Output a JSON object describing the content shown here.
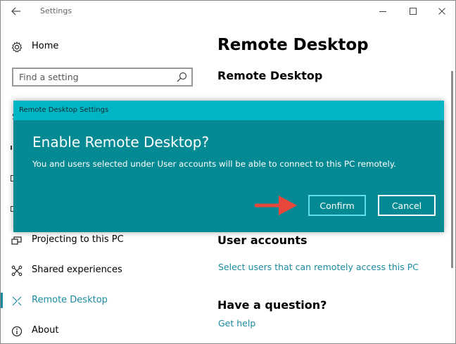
{
  "window": {
    "title": "Settings"
  },
  "sidebar": {
    "home_label": "Home",
    "search_placeholder": "Find a setting",
    "items": [
      {
        "label": "Projecting to this PC",
        "icon": "projector-icon",
        "active": false
      },
      {
        "label": "Shared experiences",
        "icon": "shared-experiences-icon",
        "active": false
      },
      {
        "label": "Remote Desktop",
        "icon": "remote-desktop-icon",
        "active": true
      },
      {
        "label": "About",
        "icon": "info-icon",
        "active": false
      }
    ],
    "peek_letter": "S"
  },
  "main": {
    "page_title": "Remote Desktop",
    "section_remote_desktop": "Remote Desktop",
    "section_user_accounts": "User accounts",
    "link_select_users": "Select users that can remotely access this PC",
    "section_question": "Have a question?",
    "link_get_help": "Get help"
  },
  "dialog": {
    "title": "Remote Desktop Settings",
    "heading": "Enable Remote Desktop?",
    "message": "You and users selected under User accounts will be able to connect to this PC remotely.",
    "confirm_label": "Confirm",
    "cancel_label": "Cancel"
  },
  "colors": {
    "accent": "#1a8a9e",
    "dialog_bg": "#058a94",
    "dialog_titlebar": "#00b6c5",
    "arrow": "#e8473c"
  }
}
